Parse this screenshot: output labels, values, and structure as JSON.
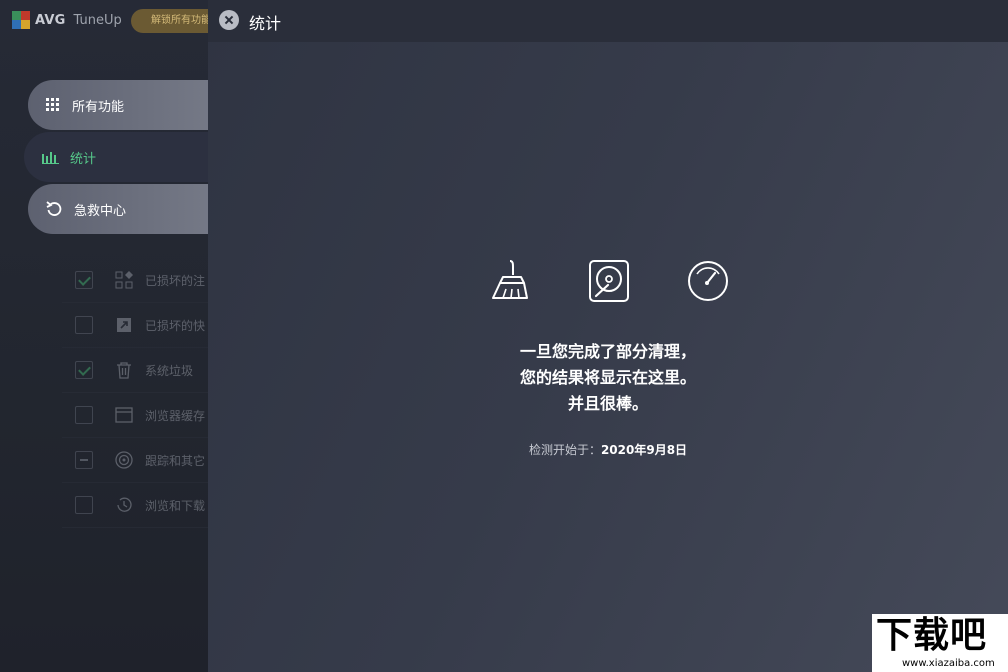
{
  "app": {
    "brand": "AVG",
    "product": "TuneUp",
    "unlock_label": "解锁所有功能"
  },
  "sidebar": {
    "items": [
      {
        "label": "所有功能",
        "icon": "grid-icon"
      },
      {
        "label": "统计",
        "icon": "bar-chart-icon",
        "active": true,
        "active_color": "#56c88a"
      },
      {
        "label": "急救中心",
        "icon": "undo-icon"
      }
    ]
  },
  "background_list": [
    {
      "label": "已损坏的注",
      "checked": true,
      "icon": "shapes-icon"
    },
    {
      "label": "已损坏的快",
      "checked": false,
      "icon": "shortcut-icon"
    },
    {
      "label": "系统垃圾",
      "checked": true,
      "icon": "trash-icon"
    },
    {
      "label": "浏览器缓存",
      "checked": false,
      "icon": "browser-window-icon"
    },
    {
      "label": "跟踪和其它",
      "checked": "partial",
      "icon": "target-icon"
    },
    {
      "label": "浏览和下载",
      "checked": false,
      "icon": "history-icon"
    }
  ],
  "panel": {
    "title": "统计",
    "icons": [
      "broom-icon",
      "hard-drive-icon",
      "speedometer-icon"
    ],
    "message_line1": "一旦您完成了部分清理，",
    "message_line2": "您的结果将显示在这里。",
    "message_line3": "并且很棒。",
    "meta_label": "检测开始于：",
    "meta_date": "2020年9月8日"
  },
  "watermark": {
    "big": "下载吧",
    "small": "www.xiazaiba.com"
  }
}
